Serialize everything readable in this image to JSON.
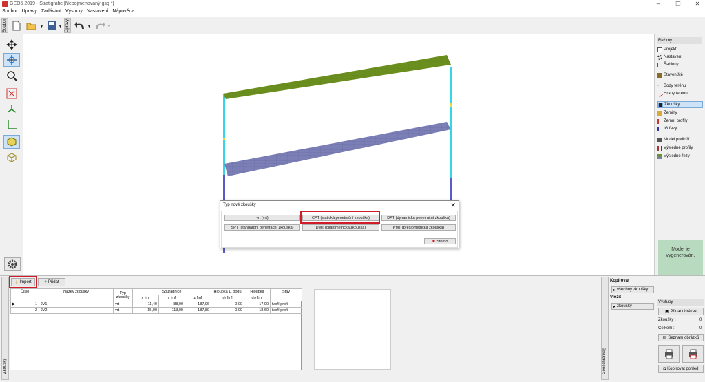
{
  "window": {
    "title": "GEO5 2019 - Stratigrafie [Nepojmenovaný.gsg *]",
    "minimize": "–",
    "maximize": "❐",
    "close": "✕"
  },
  "menu": [
    "Soubor",
    "Úpravy",
    "Zadávání",
    "Výstupy",
    "Nastavení",
    "Nápověda"
  ],
  "toolbar": {
    "tab_file": "Soubor",
    "tab_edit": "Úpravy"
  },
  "modes": {
    "header": "Režimy",
    "items": [
      "Projekt",
      "Nastavení",
      "Šablony",
      "Staveniště",
      "Body terénu",
      "Hrany terénu",
      "Zkoušky",
      "Zeminy",
      "Zemní profily",
      "IG řezy",
      "Model podloží",
      "Výsledné profily",
      "Výsledné řezy"
    ],
    "selected": "Zkoušky"
  },
  "status": {
    "message": "Model je vygenerován."
  },
  "bottom": {
    "tab_label": "Zkoušky",
    "import_label": "Import",
    "add_label": "Přidat",
    "table": {
      "headers": [
        "Číslo",
        "Název zkoušky",
        "Typ zkoušky",
        "Souřadnice",
        "Hloubka 1. bodu",
        "Hloubka",
        "Stav"
      ],
      "subheaders": [
        "",
        "",
        "",
        "x [m]",
        "y [m]",
        "z [m]",
        "d₁ [m]",
        "dₚᵣ [m]",
        ""
      ],
      "rows": [
        {
          "marker": "▶",
          "num": "1",
          "name": "JV1",
          "type": "vrt",
          "x": "11,40",
          "y": "88,00",
          "z": "187,96",
          "d1": "0,00",
          "dpr": "17,00",
          "state": "tvoří profil"
        },
        {
          "marker": "",
          "num": "2",
          "name": "JV2",
          "type": "vrt",
          "x": "15,00",
          "y": "113,00",
          "z": "187,80",
          "d1": "0,00",
          "dpr": "18,60",
          "state": "tvoří profil"
        }
      ]
    }
  },
  "clipboard": {
    "tab_label": "Geoschránka™",
    "copy_label": "Kopírovat",
    "copy_all": "všechny zkoušky",
    "paste_label": "Vložit",
    "paste_item": "zkoušky"
  },
  "outputs": {
    "header": "Výstupy",
    "add_image": "Přidat obrázek",
    "tests_label": "Zkoušky :",
    "tests_value": "0",
    "total_label": "Celkem :",
    "total_value": "0",
    "list_images": "Seznam obrázků",
    "copy_view": "Kopírovat pohled"
  },
  "dialog": {
    "title": "Typ nové zkoušky",
    "close": "✕",
    "buttons": [
      "vrt (vrt)",
      "CPT (statická penetrační zkouška)",
      "DPT (dynamická penetrační zkouška)",
      "SPT (standardní penetrační zkouška)",
      "DMT (dilatometrická zkouška)",
      "PMT (presiometrická zkouška)"
    ],
    "cancel": "Storno"
  },
  "colors": {
    "terrain_top": "#6b8f1e",
    "terrain_bottom": "#7b7fb6",
    "borehole": "#35d5e8",
    "selection_frame": "#d01c28",
    "status_bg": "#b8dbbf"
  }
}
